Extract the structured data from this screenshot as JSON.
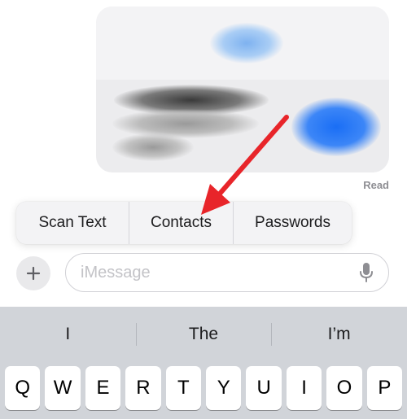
{
  "message": {
    "read_status": "Read"
  },
  "context_menu": {
    "items": [
      {
        "label": "Scan Text"
      },
      {
        "label": "Contacts"
      },
      {
        "label": "Passwords"
      }
    ]
  },
  "input_bar": {
    "plus_label": "+",
    "placeholder": "iMessage",
    "value": ""
  },
  "keyboard": {
    "suggestions": [
      "I",
      "The",
      "I’m"
    ],
    "top_row": [
      "Q",
      "W",
      "E",
      "R",
      "T",
      "Y",
      "U",
      "I",
      "O",
      "P"
    ]
  },
  "colors": {
    "arrow": "#e8252a",
    "keyboard_bg": "#d1d4d9",
    "key_bg": "#ffffff",
    "bubble_bg": "#ececee"
  }
}
